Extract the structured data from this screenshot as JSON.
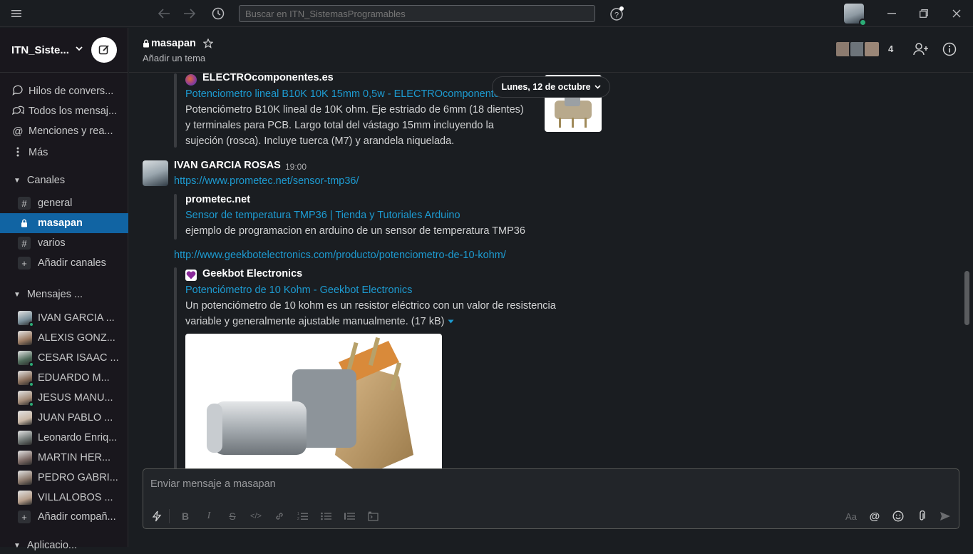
{
  "titlebar": {
    "search_placeholder": "Buscar en ITN_SistemasProgramables",
    "icons": [
      "hamburger-icon",
      "back-arrow-icon",
      "forward-arrow-icon",
      "history-icon",
      "help-icon",
      "minimize-icon",
      "restore-icon",
      "close-icon"
    ]
  },
  "sidebar": {
    "workspace_name": "ITN_Siste...",
    "nav": [
      {
        "label": "Hilos de convers...",
        "icon": "threads-icon"
      },
      {
        "label": "Todos los mensaj...",
        "icon": "all-dms-icon"
      },
      {
        "label": "Menciones y rea...",
        "icon": "mentions-icon"
      },
      {
        "label": "Más",
        "icon": "more-icon"
      }
    ],
    "channels_title": "Canales",
    "channels": [
      {
        "label": "general",
        "icon": "#",
        "active": false
      },
      {
        "label": "masapan",
        "icon": "lock",
        "active": true
      },
      {
        "label": "varios",
        "icon": "#",
        "active": false
      },
      {
        "label": "Añadir canales",
        "icon": "+",
        "active": false
      }
    ],
    "dms_title": "Mensajes ...",
    "dms": [
      {
        "label": "IVAN GARCIA ...",
        "color": "#7a8f9a",
        "online": true
      },
      {
        "label": "ALEXIS GONZ...",
        "color": "#9b7b63",
        "online": false
      },
      {
        "label": "CESAR ISAAC ...",
        "color": "#4f6a5a",
        "online": true
      },
      {
        "label": "EDUARDO M...",
        "color": "#8a6f5c",
        "online": true
      },
      {
        "label": "JESUS MANU...",
        "color": "#a38b78",
        "online": true
      },
      {
        "label": "JUAN PABLO ...",
        "color": "#c9b7a6",
        "online": false
      },
      {
        "label": "Leonardo Enriq...",
        "color": "#6e7573",
        "online": false
      },
      {
        "label": "MARTIN HER...",
        "color": "#7d6b66",
        "online": false
      },
      {
        "label": "PEDRO GABRI...",
        "color": "#8c7a6d",
        "online": false
      },
      {
        "label": "VILLALOBOS ...",
        "color": "#b59d8a",
        "online": false
      }
    ],
    "add_people": "Añadir compañ...",
    "next_section": "Aplicacio..."
  },
  "channel": {
    "name": "masapan",
    "topic": "Añadir un tema",
    "member_count": "4"
  },
  "messages": {
    "date_divider": "Lunes, 12 de octubre",
    "att1": {
      "source": "ELECTROcomponentes.es",
      "title": "Potenciometro lineal B10K 10K 15mm 0,5w - ELECTROcomponentes.es",
      "desc": [
        "Potenciómetro B10K lineal de 10K ohm. Eje estriado de 6mm (18 dientes)",
        "y terminales para PCB. Largo total del vástago 15mm incluyendo la",
        "sujeción (rosca). Incluye tuerca (M7) y arandela niquelada."
      ]
    },
    "msg2": {
      "author": "IVAN GARCIA ROSAS",
      "time": "19:00",
      "link1": "https://www.prometec.net/sensor-tmp36/",
      "att2": {
        "source": "prometec.net",
        "title": "Sensor de temperatura TMP36 | Tienda y Tutoriales Arduino",
        "desc": "ejemplo de programacion en arduino de un sensor de temperatura TMP36"
      },
      "link2": "http://www.geekbotelectronics.com/producto/potenciometro-de-10-kohm/",
      "att3": {
        "source": "Geekbot Electronics",
        "title": "Potenciómetro de 10 Kohm - Geekbot Electronics",
        "desc": [
          "Un potenciómetro de 10 kohm es un resistor eléctrico con un valor de resistencia",
          "variable y generalmente ajustable manualmente. (17 kB)"
        ]
      }
    }
  },
  "composer": {
    "placeholder": "Enviar mensaje a masapan",
    "format_labels": {
      "font_toggle": "Aa"
    }
  }
}
